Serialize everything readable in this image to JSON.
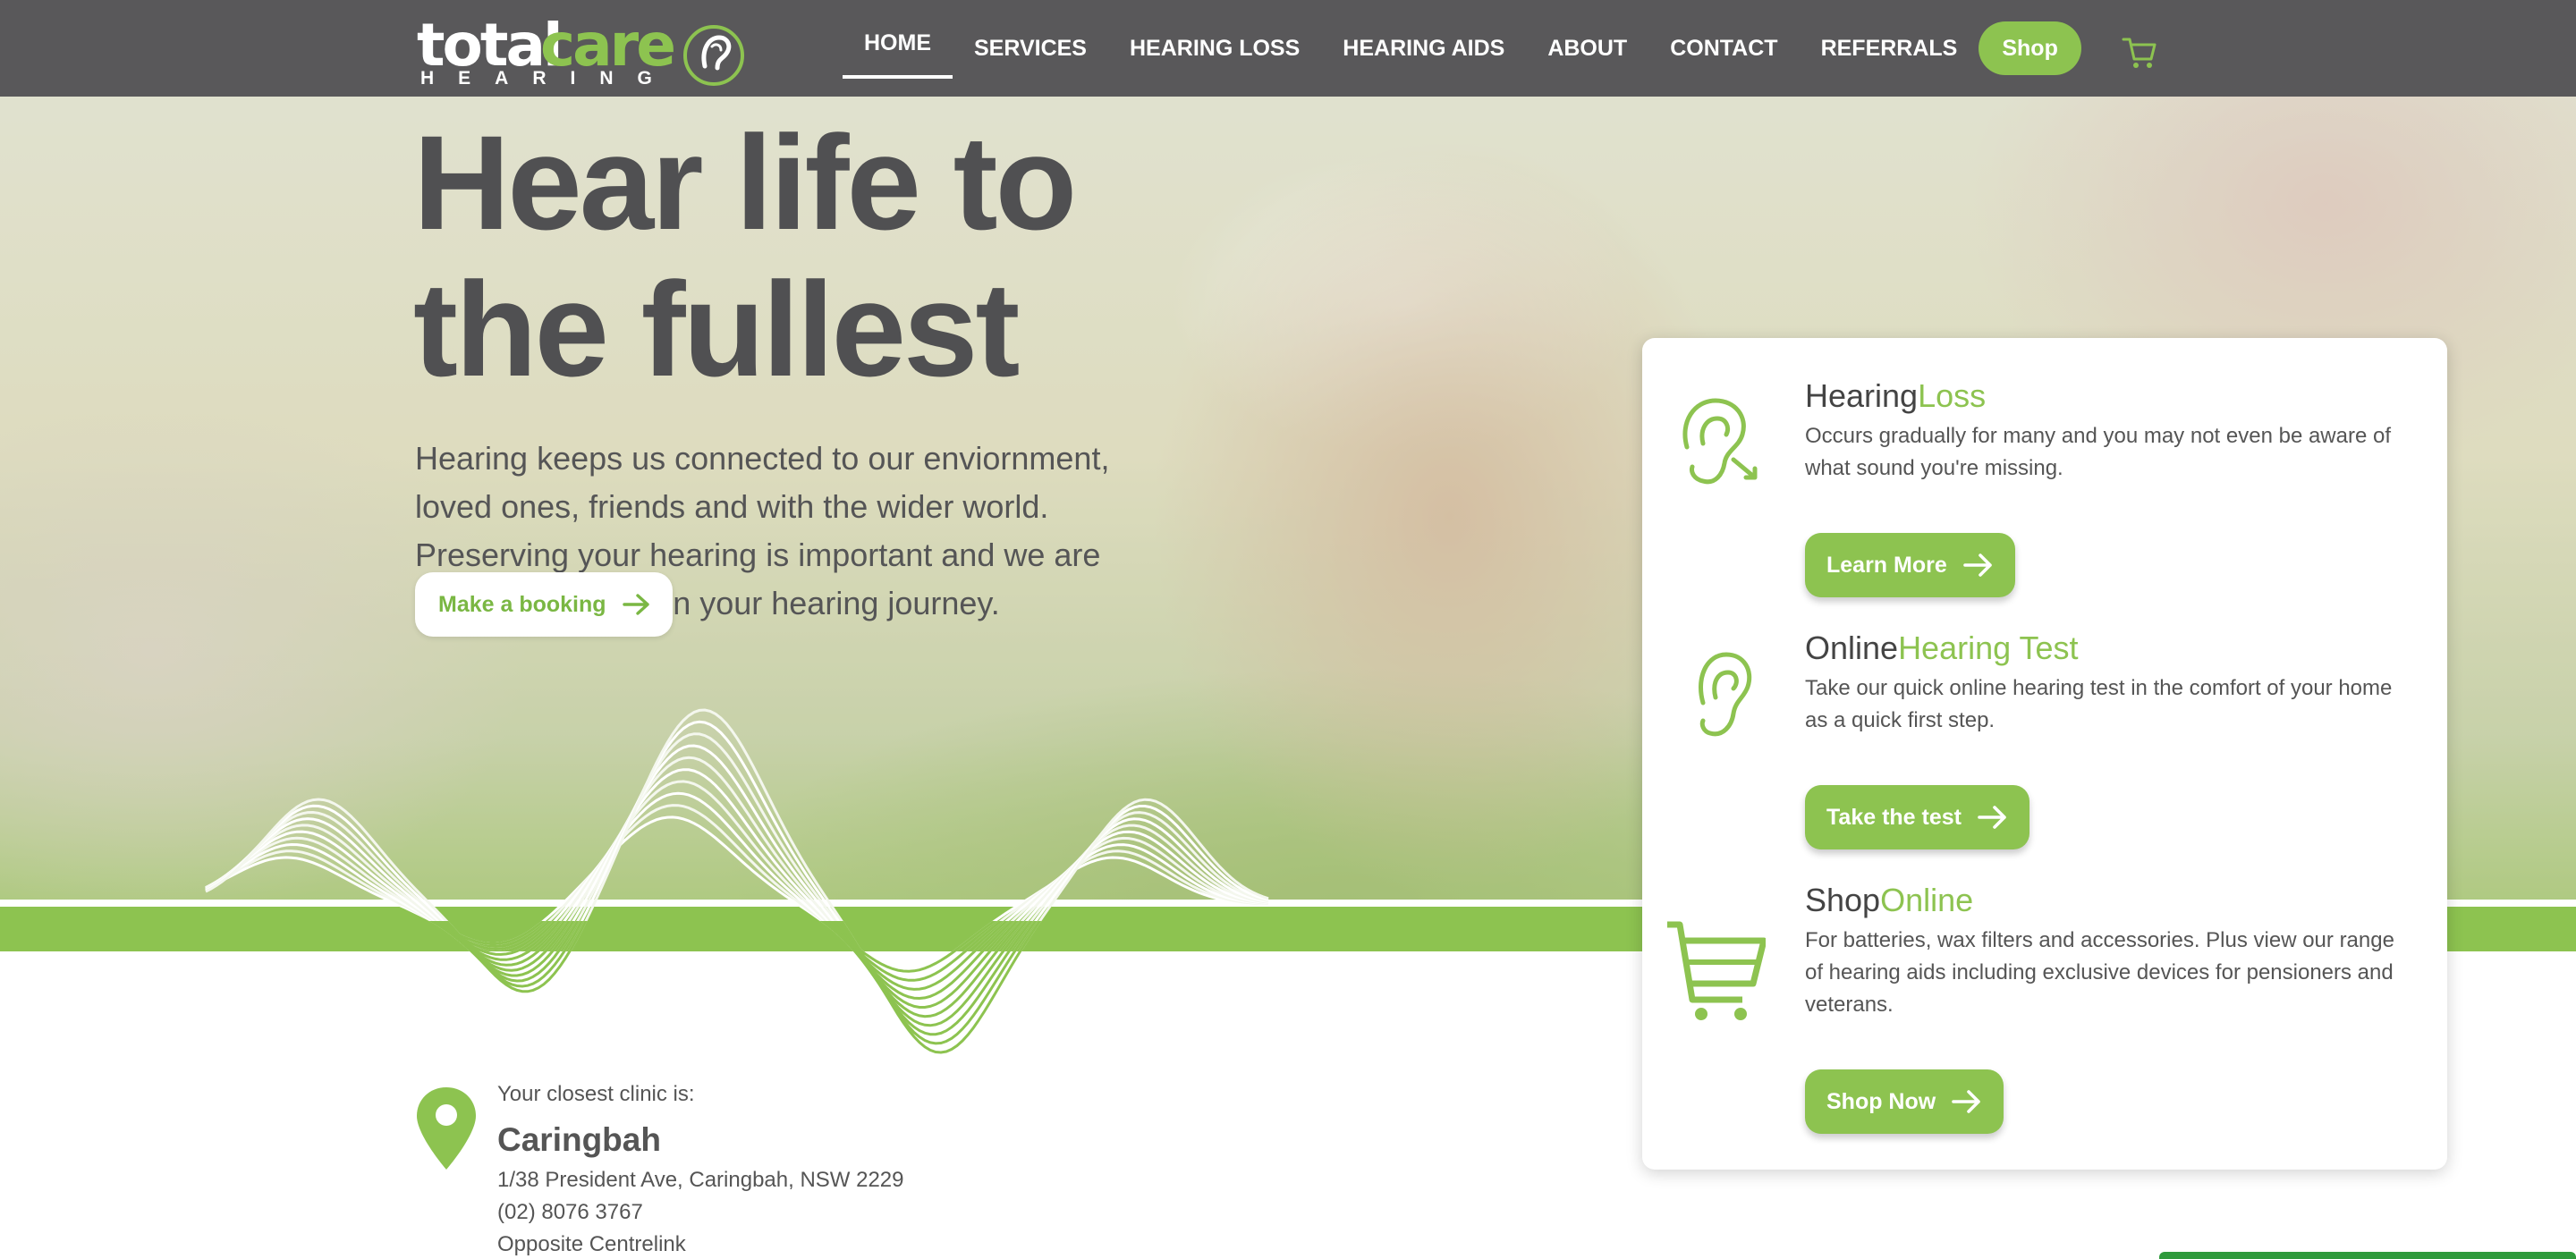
{
  "brand": {
    "name_part1": "total",
    "name_part2": "care",
    "subname": "HEARING",
    "logo_icon": "ear-swirl-icon"
  },
  "nav": {
    "items": [
      {
        "label": "HOME",
        "active": true
      },
      {
        "label": "SERVICES"
      },
      {
        "label": "HEARING LOSS"
      },
      {
        "label": "HEARING AIDS"
      },
      {
        "label": "ABOUT"
      },
      {
        "label": "CONTACT"
      },
      {
        "label": "REFERRALS"
      }
    ],
    "shop_label": "Shop",
    "cart_icon": "cart-icon"
  },
  "hero": {
    "title": "Hear life to the fullest",
    "text": "Hearing keeps us connected to our enviornment, loved ones, friends and with the wider world. Preserving your hearing is important and we are here to help you on your hearing journey.",
    "booking_label": "Make a booking"
  },
  "clinic": {
    "label": "Your closest clinic is:",
    "name": "Caringbah",
    "address": "1/38 President Ave, Caringbah, NSW 2229",
    "phone": "(02) 8076 3767",
    "note": "Opposite Centrelink"
  },
  "services": [
    {
      "title_a": "Hearing",
      "title_b": "Loss",
      "text": "Occurs gradually for many and you may not even be aware of what sound you're missing.",
      "button": "Learn More",
      "icon": "ear-sound-icon"
    },
    {
      "title_a": "Online",
      "title_b": "Hearing Test",
      "text": "Take our quick online hearing test in the comfort of your home as a quick first step.",
      "button": "Take the test",
      "icon": "ear-icon"
    },
    {
      "title_a": "Shop",
      "title_b": "Online",
      "text": "For batteries, wax filters and accessories.  Plus view our range of hearing aids including exclusive devices for pensioners and veterans.",
      "button": "Shop Now",
      "icon": "shopping-cart-icon"
    }
  ],
  "colors": {
    "brand_green": "#8dc350",
    "nav_bg": "#59585a",
    "text_dark": "#505052"
  }
}
